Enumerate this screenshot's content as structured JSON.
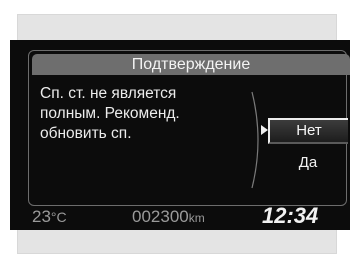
{
  "dialog": {
    "title": "Подтверждение",
    "message_lines": [
      "Сп. ст. не является",
      "полным. Рекоменд.",
      "обновить сп."
    ],
    "no_label": "Нет",
    "yes_label": "Да",
    "selected_option": "Нет"
  },
  "status": {
    "temperature": "23",
    "temperature_unit": "°C",
    "odometer": "002300",
    "odometer_unit": "km",
    "clock": "12:34"
  },
  "colors": {
    "screen_bg": "#0c0c0c",
    "title_bar": "#6e6e6e",
    "frame_bg": "#e4e4e4"
  }
}
